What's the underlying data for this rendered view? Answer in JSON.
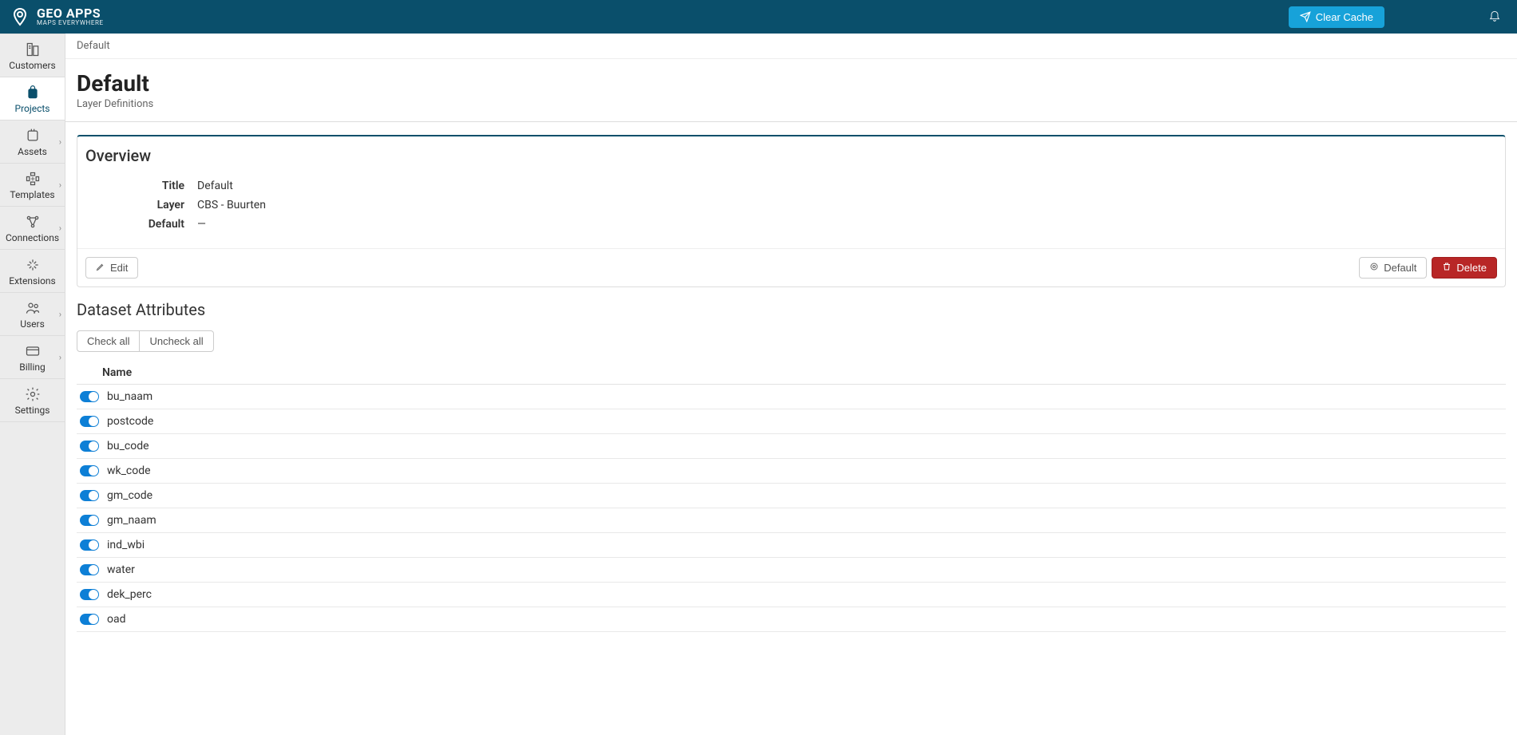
{
  "brand": {
    "title": "GEO APPS",
    "subtitle": "MAPS EVERYWHERE"
  },
  "topbar": {
    "clear_cache_label": "Clear Cache"
  },
  "sidebar": {
    "items": [
      {
        "label": "Customers",
        "has_chevron": false
      },
      {
        "label": "Projects",
        "has_chevron": false
      },
      {
        "label": "Assets",
        "has_chevron": true
      },
      {
        "label": "Templates",
        "has_chevron": true
      },
      {
        "label": "Connections",
        "has_chevron": true
      },
      {
        "label": "Extensions",
        "has_chevron": false
      },
      {
        "label": "Users",
        "has_chevron": true
      },
      {
        "label": "Billing",
        "has_chevron": true
      },
      {
        "label": "Settings",
        "has_chevron": false
      }
    ],
    "active_index": 1
  },
  "breadcrumb": "Default",
  "page": {
    "title": "Default",
    "subtitle": "Layer Definitions"
  },
  "overview": {
    "panel_title": "Overview",
    "rows": {
      "title_label": "Title",
      "title_value": "Default",
      "layer_label": "Layer",
      "layer_value": "CBS - Buurten",
      "default_label": "Default",
      "default_value": "—"
    },
    "buttons": {
      "edit": "Edit",
      "default": "Default",
      "delete": "Delete"
    }
  },
  "attributes": {
    "section_title": "Dataset Attributes",
    "check_all": "Check all",
    "uncheck_all": "Uncheck all",
    "name_header": "Name",
    "rows": [
      {
        "name": "bu_naam",
        "on": true
      },
      {
        "name": "postcode",
        "on": true
      },
      {
        "name": "bu_code",
        "on": true
      },
      {
        "name": "wk_code",
        "on": true
      },
      {
        "name": "gm_code",
        "on": true
      },
      {
        "name": "gm_naam",
        "on": true
      },
      {
        "name": "ind_wbi",
        "on": true
      },
      {
        "name": "water",
        "on": true
      },
      {
        "name": "dek_perc",
        "on": true
      },
      {
        "name": "oad",
        "on": true
      }
    ]
  }
}
